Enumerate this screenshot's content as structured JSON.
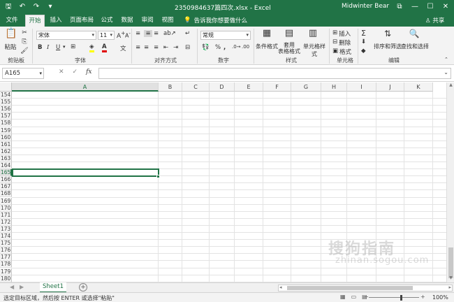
{
  "window": {
    "title": "2350984637篇四次.xlsx  -  Excel",
    "user": "Midwinter Bear",
    "qat_icons": [
      "save-icon",
      "undo-icon",
      "redo-icon",
      "customize-icon"
    ],
    "controls": [
      "minimize",
      "maximize",
      "close"
    ]
  },
  "tabs": [
    "文件",
    "开始",
    "插入",
    "页面布局",
    "公式",
    "数据",
    "审阅",
    "视图"
  ],
  "active_tab": "开始",
  "tell_me": "告诉我你想要做什么",
  "share": "共享",
  "ribbon": {
    "clipboard": {
      "label": "剪贴板",
      "paste": "粘贴"
    },
    "font": {
      "label": "字体",
      "name": "宋体",
      "size": "11",
      "bold": "B",
      "italic": "I",
      "underline": "U",
      "grow": "A",
      "shrink": "A",
      "font_color": "A"
    },
    "alignment": {
      "label": "对齐方式"
    },
    "number": {
      "label": "数字",
      "format": "常规",
      "percent": "%"
    },
    "styles": {
      "label": "样式",
      "cond_format": "条件格式",
      "format_table": "套用\n表格格式",
      "cell_styles": "单元格样式"
    },
    "cells": {
      "label": "单元格",
      "insert": "插入",
      "delete": "删除",
      "format": "格式"
    },
    "editing": {
      "label": "编辑",
      "sort_filter": "排序和筛选",
      "find_select": "查找和选择"
    }
  },
  "formula_bar": {
    "name_box": "A165",
    "fx": "fx",
    "value": ""
  },
  "grid": {
    "columns": [
      "A",
      "B",
      "C",
      "D",
      "E",
      "F",
      "G",
      "H",
      "I",
      "J",
      "K"
    ],
    "rows": [
      "154",
      "155",
      "156",
      "157",
      "158",
      "159",
      "160",
      "161",
      "162",
      "163",
      "164",
      "165",
      "166",
      "167",
      "168",
      "169",
      "170",
      "171",
      "172",
      "173",
      "174",
      "175",
      "176",
      "177",
      "178",
      "179",
      "180"
    ],
    "active_col": "A",
    "active_row": "165"
  },
  "sheets": [
    "Sheet1"
  ],
  "status": {
    "message": "选定目标区域，然后按 ENTER 或选择\"粘贴\"",
    "zoom": "100%"
  },
  "watermark": {
    "text": "搜狗指南",
    "url": "zhinan.sogou.com"
  },
  "colors": {
    "accent": "#217346"
  }
}
